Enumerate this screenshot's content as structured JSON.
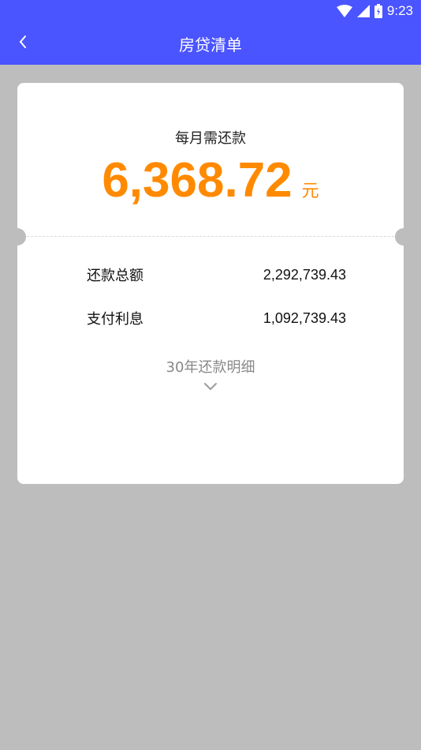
{
  "status_bar": {
    "time": "9:23"
  },
  "app_bar": {
    "title": "房贷清单"
  },
  "summary": {
    "monthly_label": "每月需还款",
    "monthly_amount": "6,368.72",
    "unit": "元",
    "rows": [
      {
        "label": "还款总额",
        "value": "2,292,739.43"
      },
      {
        "label": "支付利息",
        "value": "1,092,739.43"
      }
    ],
    "detail_toggle": "30年还款明细"
  },
  "colors": {
    "primary": "#4a54ff",
    "accent": "#ff8a00",
    "background": "#bdbdbd"
  },
  "icons": [
    "wifi-icon",
    "signal-icon",
    "battery-icon",
    "back-arrow-icon",
    "chevron-down-icon"
  ]
}
